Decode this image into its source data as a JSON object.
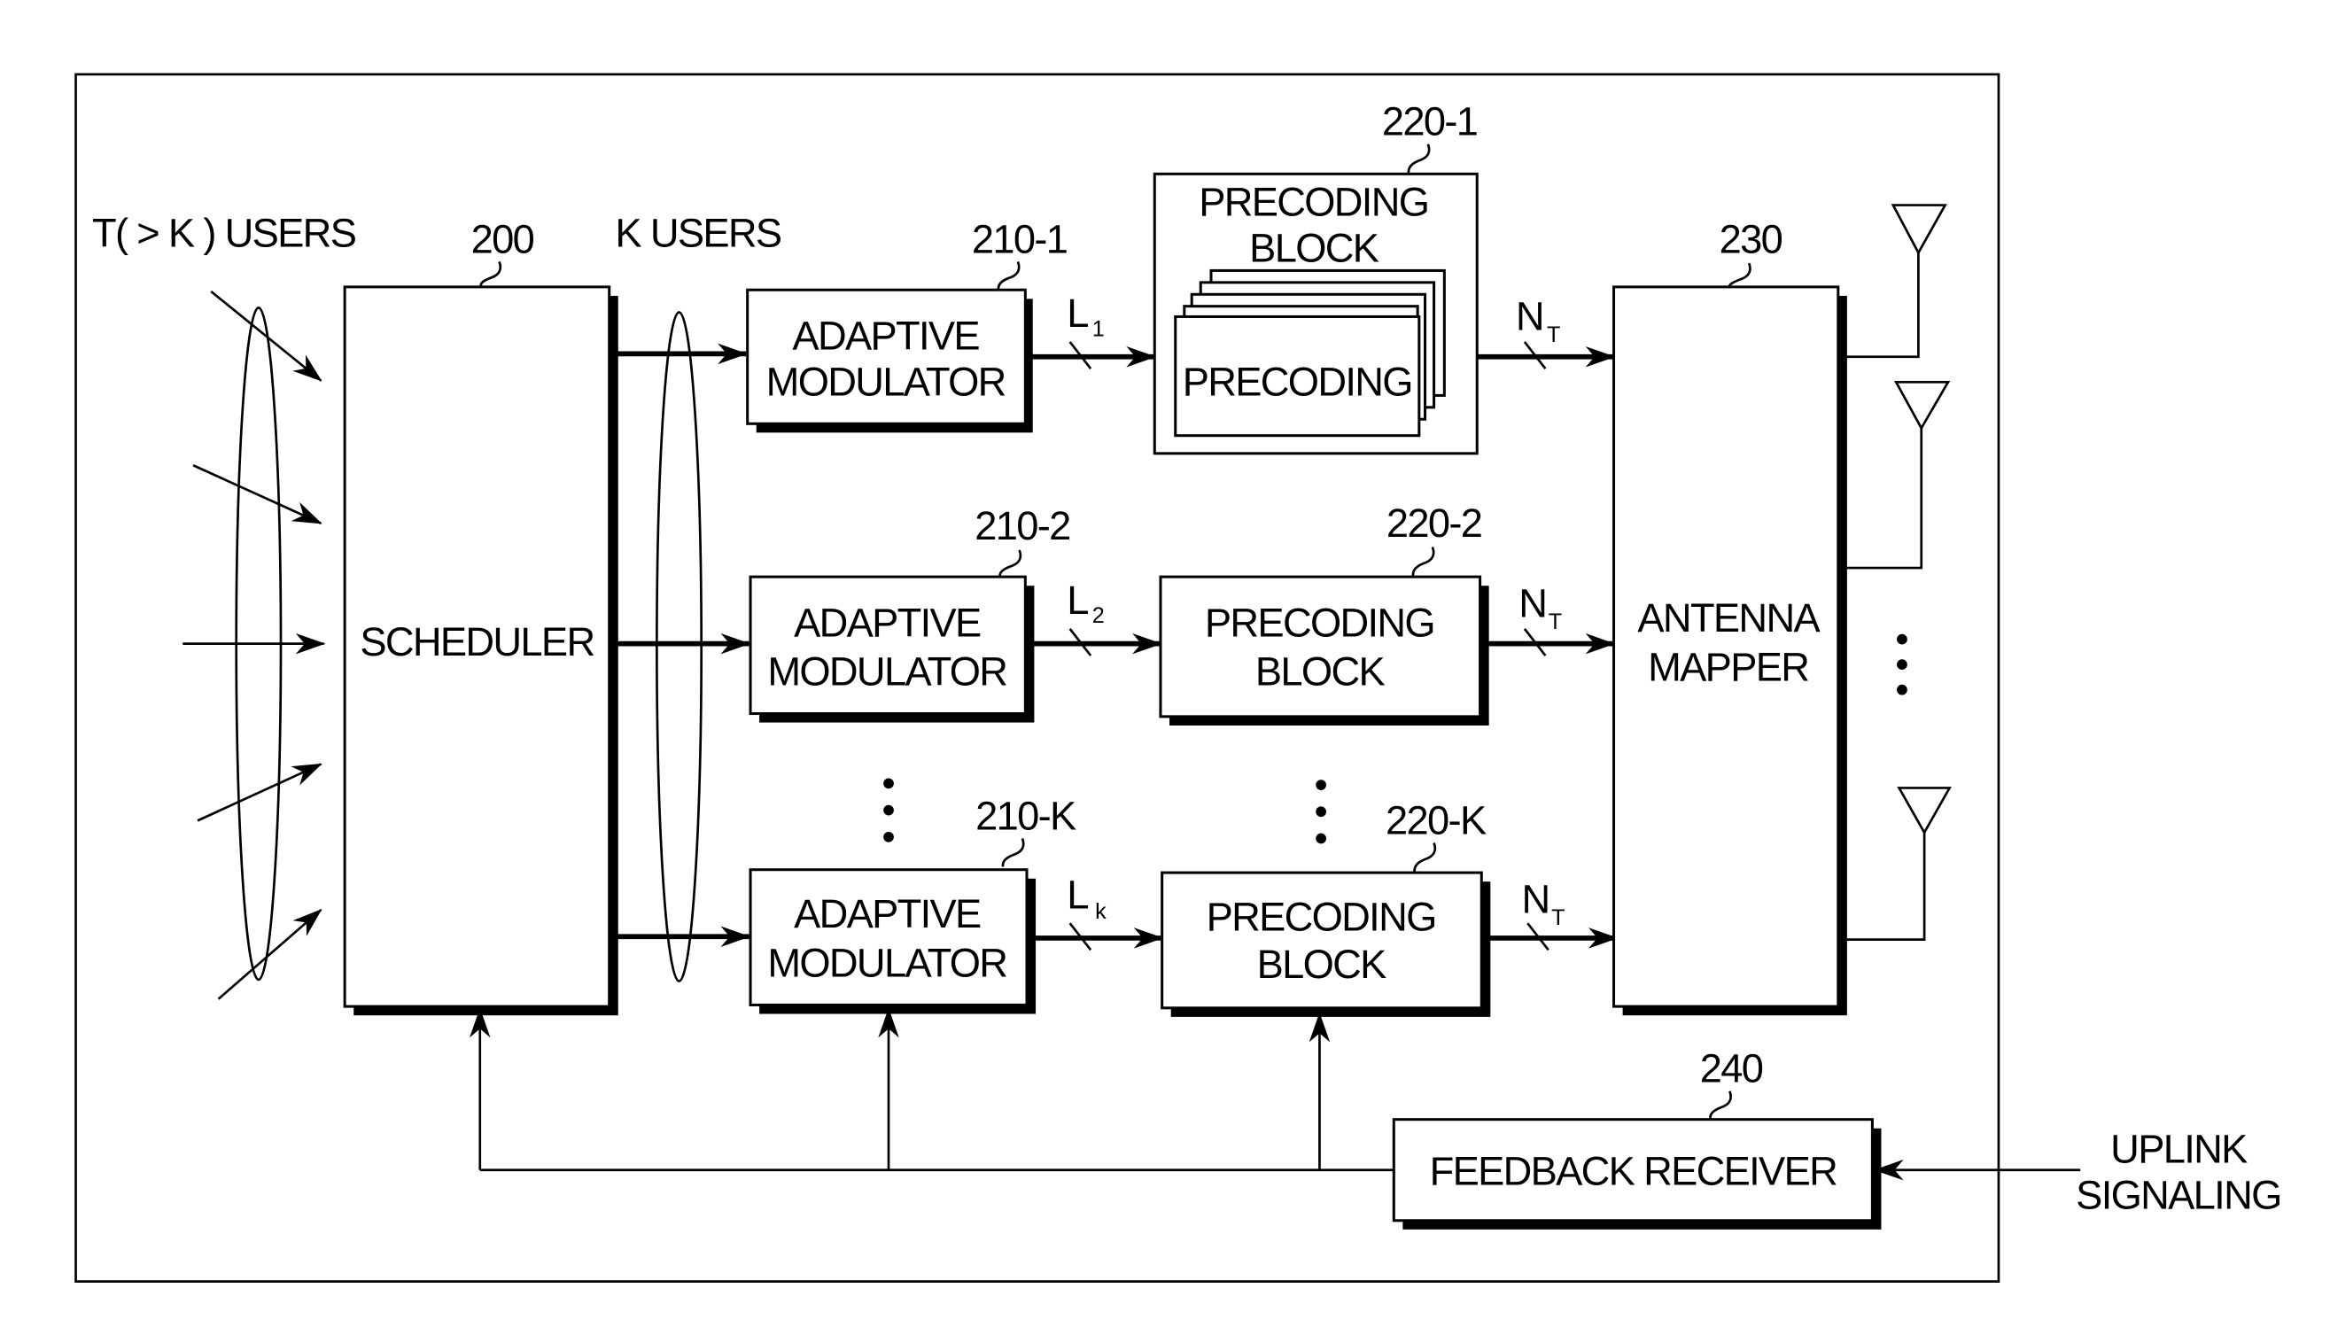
{
  "figure": {
    "header_labels": {
      "input_users": "T( > K ) USERS",
      "selected_users": "K  USERS"
    },
    "blocks": {
      "scheduler": {
        "ref": "200",
        "label": "SCHEDULER"
      },
      "adaptive_modulators": [
        {
          "ref": "210-1",
          "line1": "ADAPTIVE",
          "line2": "MODULATOR",
          "output_stream": "L",
          "output_sub": "1"
        },
        {
          "ref": "210-2",
          "line1": "ADAPTIVE",
          "line2": "MODULATOR",
          "output_stream": "L",
          "output_sub": "2"
        },
        {
          "ref": "210-K",
          "line1": "ADAPTIVE",
          "line2": "MODULATOR",
          "output_stream": "L",
          "output_sub": "k"
        }
      ],
      "precoding_blocks": [
        {
          "ref": "220-1",
          "line1": "PRECODING",
          "line2": "BLOCK",
          "inner_label": "PRECODING",
          "output_stream": "N",
          "output_sub": "T"
        },
        {
          "ref": "220-2",
          "line1": "PRECODING",
          "line2": "BLOCK",
          "output_stream": "N",
          "output_sub": "T"
        },
        {
          "ref": "220-K",
          "line1": "PRECODING",
          "line2": "BLOCK",
          "output_stream": "N",
          "output_sub": "T"
        }
      ],
      "antenna_mapper": {
        "ref": "230",
        "line1": "ANTENNA",
        "line2": "MAPPER"
      },
      "feedback_receiver": {
        "ref": "240",
        "label": "FEEDBACK RECEIVER"
      }
    },
    "external_input": {
      "line1": "UPLINK",
      "line2": "SIGNALING"
    },
    "icons": {
      "antenna": "antenna-icon",
      "ellipsis": "vertical-ellipsis-icon"
    }
  }
}
